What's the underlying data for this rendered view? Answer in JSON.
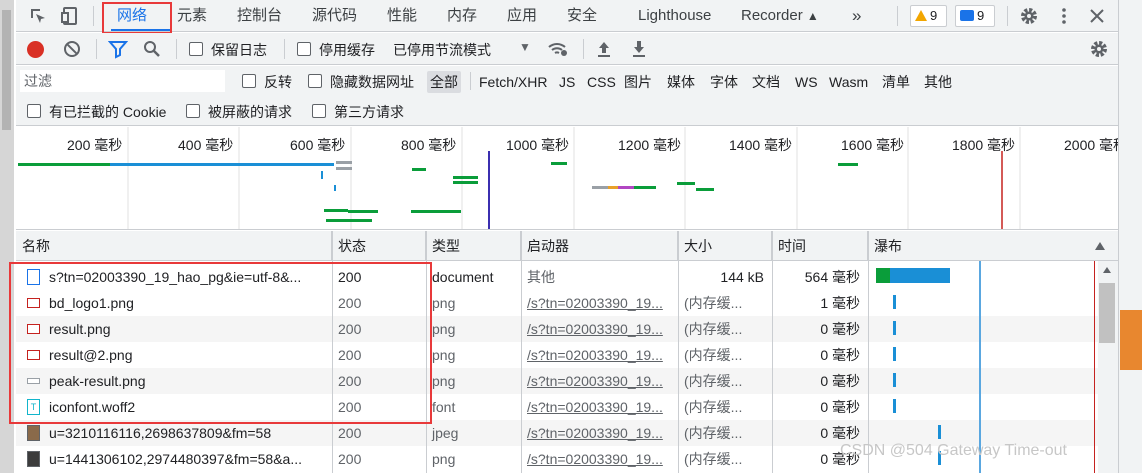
{
  "tabs": [
    {
      "label": "网络",
      "active": true
    },
    {
      "label": "元素"
    },
    {
      "label": "控制台"
    },
    {
      "label": "源代码"
    },
    {
      "label": "性能"
    },
    {
      "label": "内存"
    },
    {
      "label": "应用"
    },
    {
      "label": "安全"
    },
    {
      "label": "Lighthouse"
    },
    {
      "label": "Recorder"
    }
  ],
  "more_tabs": "»",
  "badges": {
    "warnings": "9",
    "messages": "9"
  },
  "toolbar": {
    "preserve_log": "保留日志",
    "disable_cache": "停用缓存",
    "throttling": "已停用节流模式"
  },
  "filter": {
    "placeholder": "过滤",
    "invert": "反转",
    "hide_data_urls": "隐藏数据网址",
    "types": [
      "全部",
      "Fetch/XHR",
      "JS",
      "CSS",
      "图片",
      "媒体",
      "字体",
      "文档",
      "WS",
      "Wasm",
      "清单",
      "其他"
    ]
  },
  "row3": {
    "blocked_cookies": "有已拦截的 Cookie",
    "blocked_requests": "被屏蔽的请求",
    "third_party": "第三方请求"
  },
  "overview": {
    "ticks": [
      "200 毫秒",
      "400 毫秒",
      "600 毫秒",
      "800 毫秒",
      "1000 毫秒",
      "1200 毫秒",
      "1400 毫秒",
      "1600 毫秒",
      "1800 毫秒",
      "2000 毫秒"
    ]
  },
  "columns": {
    "name": "名称",
    "status": "状态",
    "type": "类型",
    "initiator": "启动器",
    "size": "大小",
    "time": "时间",
    "waterfall": "瀑布"
  },
  "rows": [
    {
      "name": "s?tn=02003390_19_hao_pg&ie=utf-8&...",
      "status": "200",
      "type": "document",
      "initiator": "其他",
      "size": "144 kB",
      "time": "564 毫秒",
      "icon": "document-icon"
    },
    {
      "name": "bd_logo1.png",
      "status": "200",
      "type": "png",
      "initiator": "/s?tn=02003390_19...",
      "size": "(内存缓...",
      "time": "1 毫秒",
      "icon": "image-icon"
    },
    {
      "name": "result.png",
      "status": "200",
      "type": "png",
      "initiator": "/s?tn=02003390_19...",
      "size": "(内存缓...",
      "time": "0 毫秒",
      "icon": "image-icon"
    },
    {
      "name": "result@2.png",
      "status": "200",
      "type": "png",
      "initiator": "/s?tn=02003390_19...",
      "size": "(内存缓...",
      "time": "0 毫秒",
      "icon": "image-icon"
    },
    {
      "name": "peak-result.png",
      "status": "200",
      "type": "png",
      "initiator": "/s?tn=02003390_19...",
      "size": "(内存缓...",
      "time": "0 毫秒",
      "icon": "image-icon"
    },
    {
      "name": "iconfont.woff2",
      "status": "200",
      "type": "font",
      "initiator": "/s?tn=02003390_19...",
      "size": "(内存缓...",
      "time": "0 毫秒",
      "icon": "font-icon"
    },
    {
      "name": "u=3210116116,2698637809&fm=58",
      "status": "200",
      "type": "jpeg",
      "initiator": "/s?tn=02003390_19...",
      "size": "(内存缓...",
      "time": "0 毫秒",
      "icon": "photo-icon"
    },
    {
      "name": "u=1441306102,2974480397&fm=58&a...",
      "status": "200",
      "type": "png",
      "initiator": "/s?tn=02003390_19...",
      "size": "(内存缓...",
      "time": "0 毫秒",
      "icon": "photo-icon"
    }
  ],
  "colors": {
    "accent": "#1a73e8",
    "highlight_box": "#e8393a",
    "record": "#d93025"
  },
  "watermark": "CSDN @504 Gateway Time-out"
}
